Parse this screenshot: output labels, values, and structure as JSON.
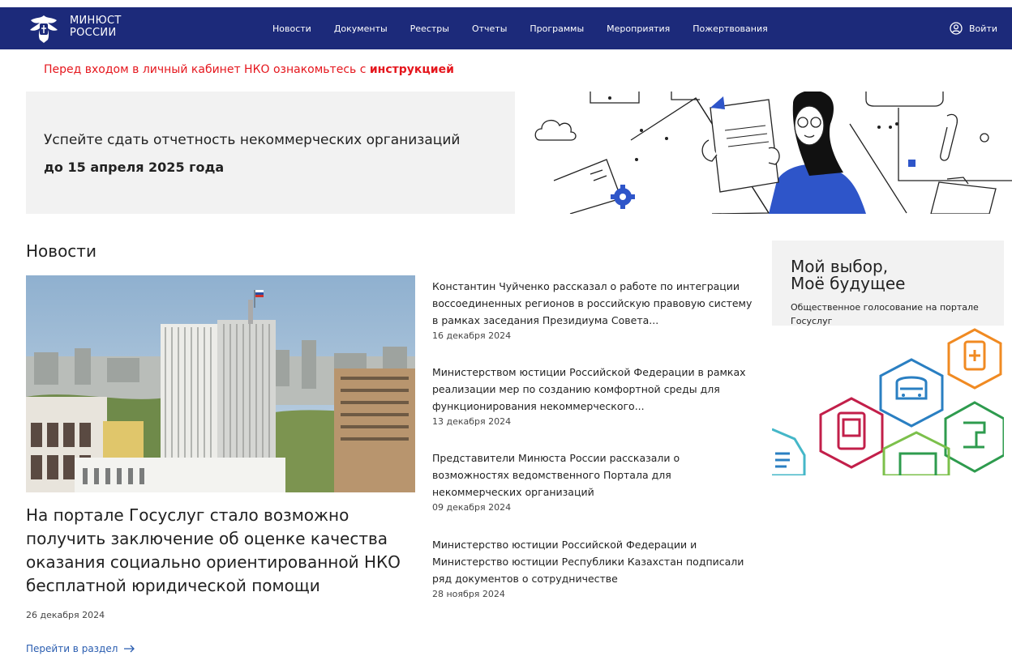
{
  "header": {
    "logo_line1": "МИНЮСТ",
    "logo_line2": "РОССИИ",
    "nav": [
      "Новости",
      "Документы",
      "Реестры",
      "Отчеты",
      "Программы",
      "Мероприятия",
      "Пожертвования"
    ],
    "login_label": "Войти",
    "bg_color": "#1c2a7a"
  },
  "notice": {
    "text": "Перед входом в личный кабинет НКО ознакомьтесь с ",
    "link": "инструкцией",
    "color": "#e5161d"
  },
  "banner": {
    "line1": "Успейте сдать отчетность некоммерческих организаций",
    "line2": "до 15 апреля 2025 года"
  },
  "news": {
    "section_title": "Новости",
    "main": {
      "headline": "На портале Госуслуг стало возможно получить заключение об оценке качества оказания социально ориентированной НКО бесплатной юридической помощи",
      "date": "26 декабря 2024"
    },
    "items": [
      {
        "title": "Константин Чуйченко рассказал о работе по интеграции воссоединенных регионов в российскую правовую систему в рамках заседания Президиума Совета...",
        "date": "16 декабря 2024"
      },
      {
        "title": "Министерством юстиции Российской Федерации в рамках реализации мер по созданию комфортной среды для функционирования некоммерческого...",
        "date": "13 декабря 2024"
      },
      {
        "title": "Представители Минюста России рассказали о возможностях ведомственного Портала для некоммерческих организаций",
        "date": "09 декабря 2024"
      },
      {
        "title": "Министерство юстиции Российской Федерации и Министерство юстиции Республики Казахстан подписали ряд документов о сотрудничестве",
        "date": "28 ноября 2024"
      }
    ],
    "goto_label": "Перейти в раздел"
  },
  "promo": {
    "heading_line1": "Мой выбор,",
    "heading_line2": "Моё будущее",
    "sub": "Общественное голосование на портале Госуслуг"
  }
}
